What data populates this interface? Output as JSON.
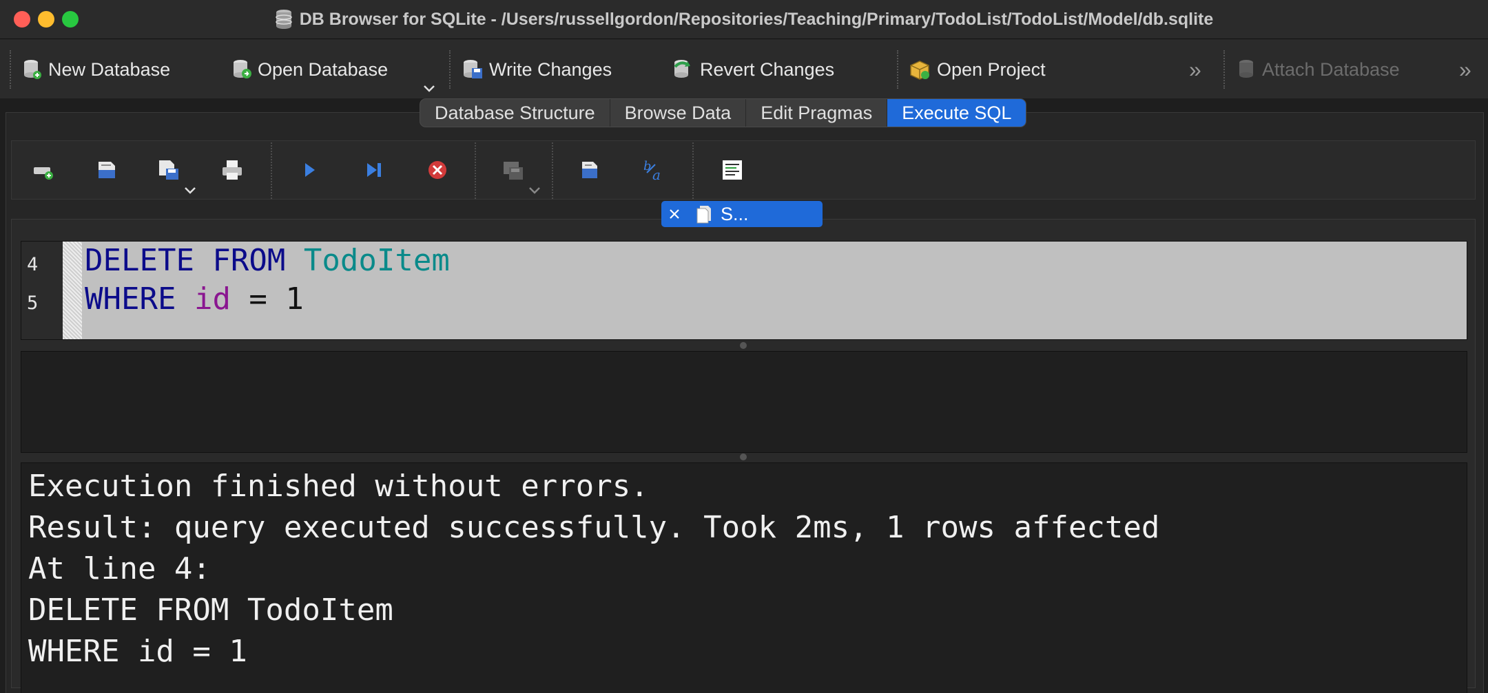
{
  "window": {
    "title": "DB Browser for SQLite - /Users/russellgordon/Repositories/Teaching/Primary/TodoList/TodoList/Model/db.sqlite",
    "traffic_lights": [
      "#ff5f57",
      "#febc2e",
      "#28c840"
    ]
  },
  "toolbar": {
    "new_database": "New Database",
    "open_database": "Open Database",
    "write_changes": "Write Changes",
    "revert_changes": "Revert Changes",
    "open_project": "Open Project",
    "attach_database": "Attach Database",
    "overflow": "»"
  },
  "tabs": [
    {
      "label": "Database Structure",
      "active": false
    },
    {
      "label": "Browse Data",
      "active": false
    },
    {
      "label": "Edit Pragmas",
      "active": false
    },
    {
      "label": "Execute SQL",
      "active": true
    }
  ],
  "sql_toolbar": {
    "icons": [
      "open-tab-icon",
      "open-sql-file-icon",
      "save-sql-file-icon",
      "print-icon",
      "execute-all-icon",
      "execute-line-icon",
      "stop-execution-icon",
      "save-results-icon",
      "find-icon",
      "find-replace-icon",
      "comment-icon"
    ]
  },
  "editor_tab": {
    "label": "S..."
  },
  "editor": {
    "lines": [
      {
        "number": "4",
        "tokens": [
          {
            "text": "DELETE FROM ",
            "kind": "kw"
          },
          {
            "text": "TodoItem",
            "kind": "tbl"
          }
        ]
      },
      {
        "number": "5",
        "tokens": [
          {
            "text": "WHERE ",
            "kind": "kw"
          },
          {
            "text": "id",
            "kind": "col"
          },
          {
            "text": " = 1",
            "kind": "plain"
          }
        ]
      }
    ]
  },
  "message": {
    "lines": [
      "Execution finished without errors.",
      "Result: query executed successfully. Took 2ms, 1 rows affected",
      "At line 4:",
      "DELETE FROM TodoItem",
      "WHERE id = 1"
    ]
  },
  "colors": {
    "accent": "#1f6ad9",
    "keyword": "#0b0b8a",
    "table": "#0a8a8a",
    "column": "#8a1690"
  }
}
